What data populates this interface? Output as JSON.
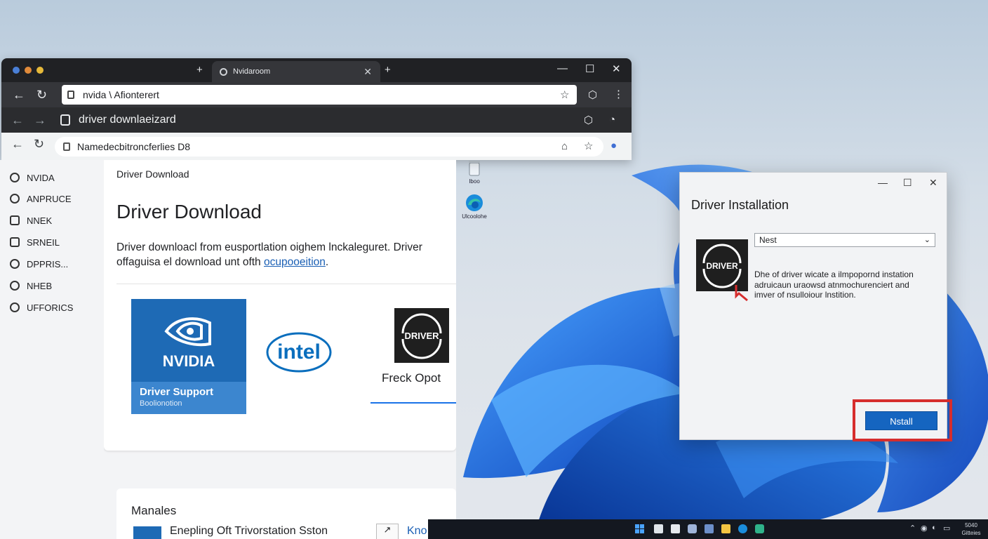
{
  "browser": {
    "tab_title": "Nvidaroom",
    "omnibox_1": "nvida \\ Afionterert",
    "url_2": "driver downlaeizard",
    "omnibox_3": "Namedecbitroncferlies D8"
  },
  "sidebar": {
    "items": [
      {
        "label": "NVIDA",
        "icon": "car-icon"
      },
      {
        "label": "ANPRUCE",
        "icon": "users-icon"
      },
      {
        "label": "NNEK",
        "icon": "list-icon"
      },
      {
        "label": "SRNEIL",
        "icon": "monitor-icon"
      },
      {
        "label": "DPPRIS...",
        "icon": "disc-icon"
      },
      {
        "label": "NHEB",
        "icon": "globe-icon"
      },
      {
        "label": "UFFORICS",
        "icon": "location-pin-icon"
      }
    ]
  },
  "content": {
    "breadcrumb": "Driver Download",
    "title": "Driver Download",
    "desc_line1": "Driver downloacl from eusportlation oighem lnckaleguret. Driver",
    "desc_line2": "offaguisa el download unt ofth",
    "desc_link": "ocupooeition",
    "desc_end": ".",
    "nvidia_word": "NVIDIA",
    "nvidia_support": "Driver Support",
    "nvidia_sub": "Boolionotion",
    "intel_word": "intel",
    "driver_caption": "Freck Opot",
    "logo_text": "DRIVER",
    "card2_title": "Manales",
    "card2_row_text": "Enepling Oft Trivorstation Sston",
    "card2_row_button": "↗",
    "card2_row_link": "Kno"
  },
  "desktop_icons": [
    {
      "label": "Iboo",
      "icon": "recycle-bin-icon"
    },
    {
      "label": "Ulcoolohe",
      "icon": "edge-browser-icon"
    }
  ],
  "dialog": {
    "title": "Driver Installation",
    "select_value": "Nest",
    "logo_text": "DRIVER",
    "desc_line1": "Dhe of driver wicate a ilmpopornd instation",
    "desc_line2": "adruicaun uraowsd atnmochurenciert and",
    "desc_line3": "imver of nsulloiour lnstition.",
    "install_label": "Nstall"
  },
  "taskbar": {
    "clock_line1": "5040",
    "clock_line2": "Gitteies"
  },
  "colors": {
    "accent": "#1565c0",
    "highlight": "#d62d2d",
    "nvidia_blue": "#1e6ab5"
  }
}
